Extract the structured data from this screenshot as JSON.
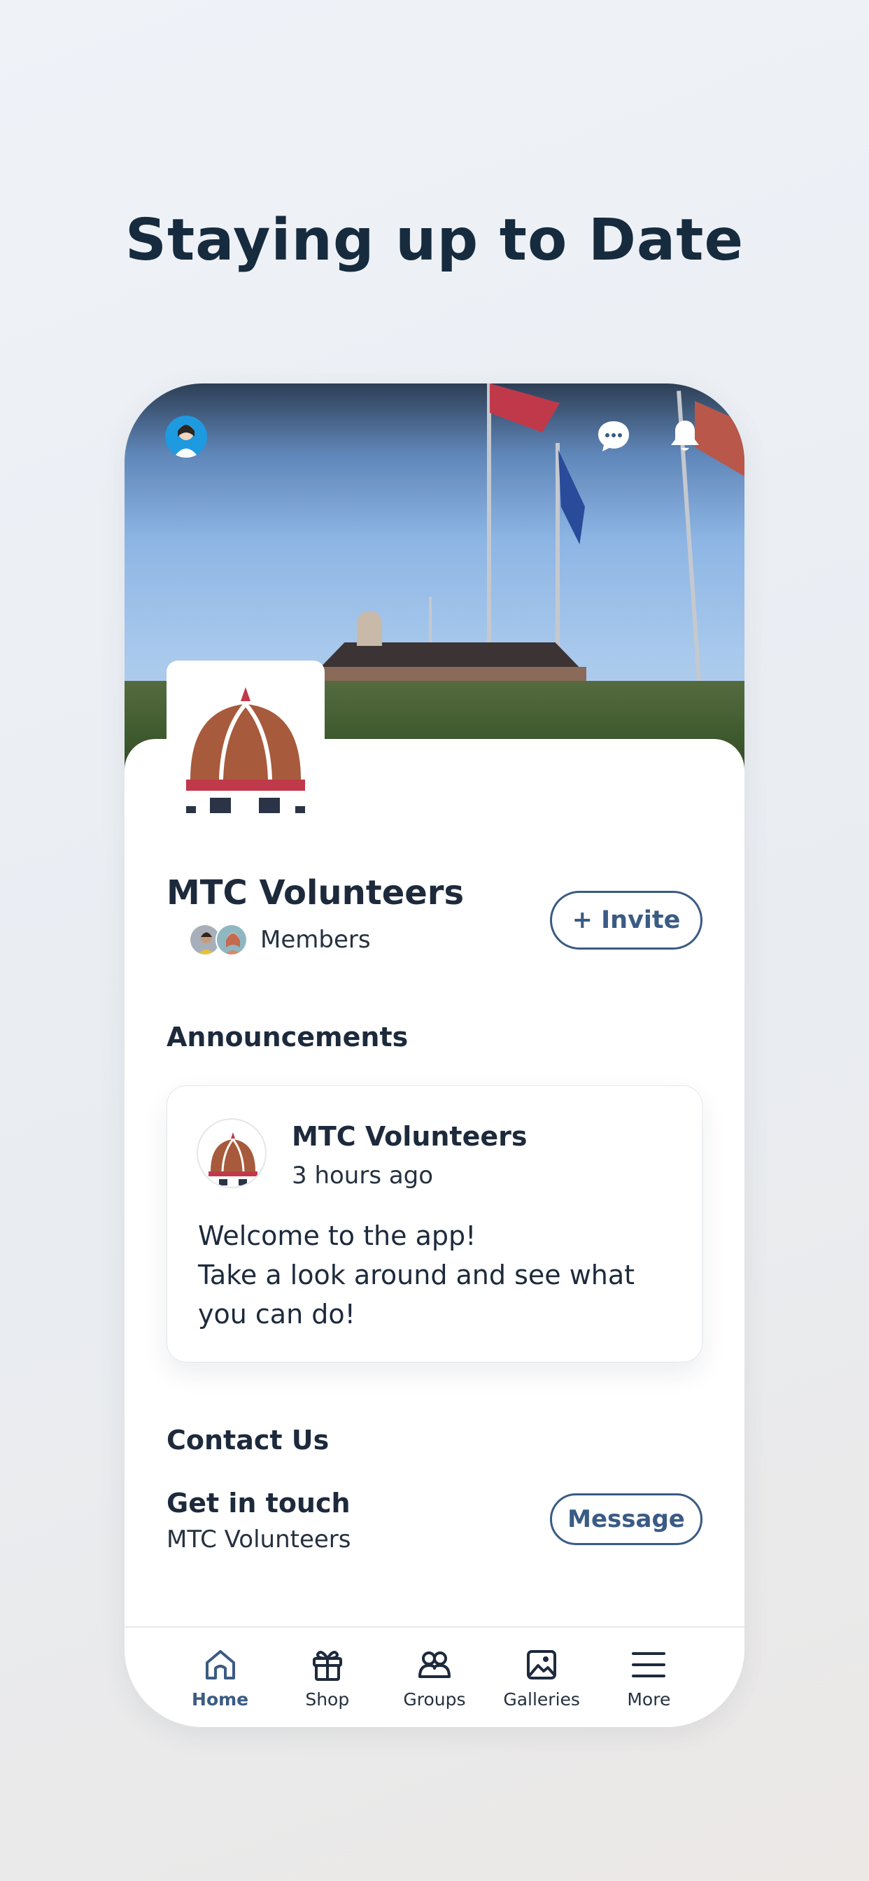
{
  "headline": "Staying up to Date",
  "group": {
    "name": "MTC Volunteers",
    "members_label": "Members",
    "invite_label": "+ Invite"
  },
  "announcements": {
    "section_title": "Announcements",
    "post": {
      "author": "MTC Volunteers",
      "time": "3 hours ago",
      "text": "Welcome to the app!\nTake a look around and see what you can do!"
    }
  },
  "contact": {
    "section_title": "Contact Us",
    "title": "Get in touch",
    "subtitle": "MTC Volunteers",
    "message_label": "Message"
  },
  "nav": {
    "items": [
      {
        "label": "Home",
        "icon": "home-icon",
        "active": true
      },
      {
        "label": "Shop",
        "icon": "gift-icon",
        "active": false
      },
      {
        "label": "Groups",
        "icon": "groups-icon",
        "active": false
      },
      {
        "label": "Galleries",
        "icon": "image-icon",
        "active": false
      },
      {
        "label": "More",
        "icon": "menu-icon",
        "active": false
      }
    ]
  },
  "colors": {
    "accent": "#3a5b84",
    "text": "#1d2a3c",
    "dome": "#a85a3c",
    "dome_band": "#c0394a",
    "base": "#2b3446"
  }
}
